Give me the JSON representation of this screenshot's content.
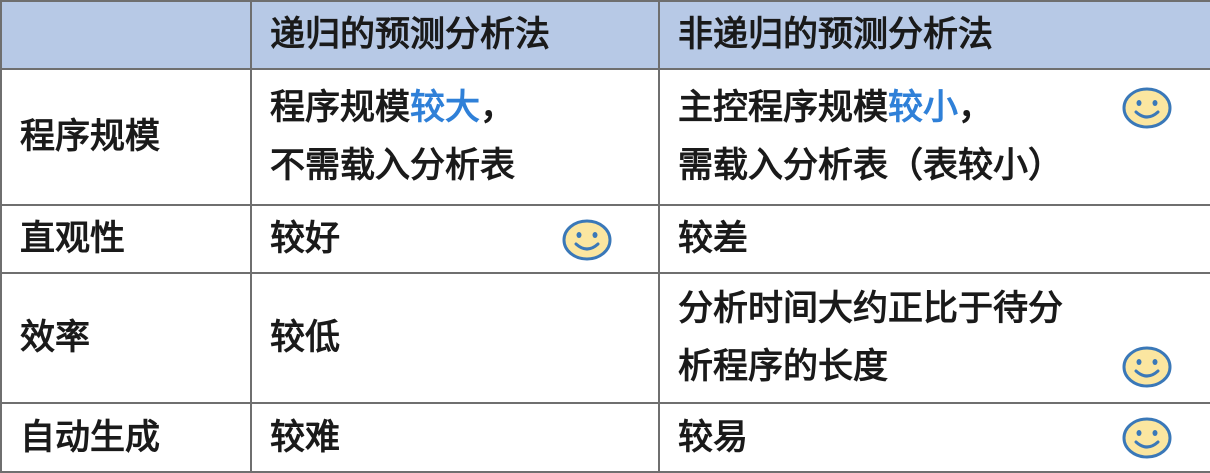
{
  "header": {
    "corner": "",
    "col_recursive": "递归的预测分析法",
    "col_nonrecursive": "非递归的预测分析法"
  },
  "rows": [
    {
      "label": "程序规模",
      "recursive": {
        "line1_pre": "程序规模",
        "line1_hl": "较大",
        "line1_post": "，",
        "line2": "不需载入分析表"
      },
      "nonrecursive": {
        "line1_pre": "主控程序规模",
        "line1_hl": "较小",
        "line1_post": "，",
        "line2": "需载入分析表（表较小）"
      }
    },
    {
      "label": "直观性",
      "recursive": "较好",
      "nonrecursive": "较差"
    },
    {
      "label": "效率",
      "recursive": "较低",
      "nonrecursive": {
        "line1": "分析时间大约正比于待分",
        "line2": "析程序的长度"
      }
    },
    {
      "label": "自动生成",
      "recursive": "较难",
      "nonrecursive": "较易"
    }
  ],
  "colors": {
    "header_bg": "#b7c9e6",
    "highlight": "#2f80d8",
    "border": "#6f6f6f",
    "smiley_fill": "#fbe6a0",
    "smiley_stroke": "#3a78b8"
  },
  "icons": [
    "smiley-icon"
  ]
}
